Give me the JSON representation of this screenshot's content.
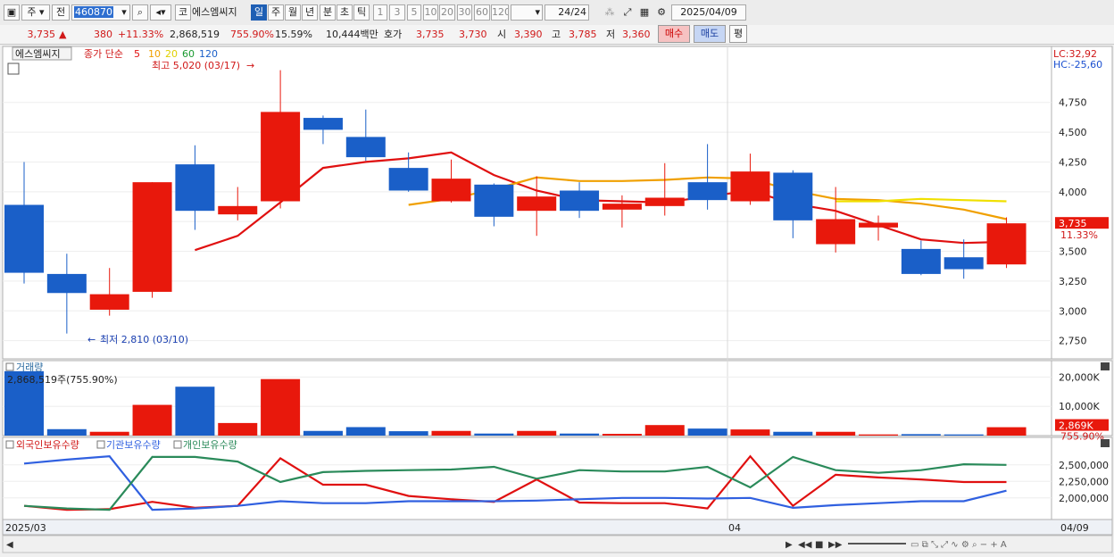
{
  "toolbar": {
    "market_sel": "주",
    "prev_sel": "전",
    "stock_code": "460870",
    "code_btn": "코",
    "stock_name": "에스엠씨지",
    "periods": [
      "일",
      "주",
      "월",
      "년",
      "분",
      "초",
      "틱"
    ],
    "active_period": "일",
    "intervals": [
      "1",
      "3",
      "5",
      "10",
      "20",
      "30",
      "60",
      "120"
    ],
    "count": "24",
    "count_total": "/24",
    "date": "2025/04/09"
  },
  "quote": {
    "price": "3,735",
    "change_arrow": "▲",
    "change": "380",
    "change_pct": "+11.33%",
    "volume": "2,868,519",
    "volume_ratio": "755.90%",
    "turnover": "15.59%",
    "amount": "10,444백만",
    "hoga_label": "호가",
    "ask": "3,735",
    "bid": "3,730",
    "open_label": "시",
    "open": "3,390",
    "high_label": "고",
    "high": "3,785",
    "low_label": "저",
    "low": "3,360",
    "buy_btn": "매수",
    "sell_btn": "매도",
    "eval_btn": "평"
  },
  "colors": {
    "up": "#e8180c",
    "down": "#1a5fc8",
    "ma5": "#e01010",
    "ma10": "#f0a000",
    "ma20": "#f0e000",
    "ma60": "#1a9a30",
    "ma120": "#1a5fc8",
    "foreign": "#e01010",
    "inst": "#3060e0",
    "indiv": "#2a8a5a"
  },
  "price_panel": {
    "name_tag": "에스엠씨지",
    "legend_prefix": "종가 단순",
    "legend_periods": [
      "5",
      "10",
      "20",
      "60",
      "120"
    ],
    "max_label": "최고 5,020 (03/17)",
    "min_label": "최저 2,810 (03/10)",
    "lc": "LC:32,92",
    "hc": "HC:-25,60",
    "last_price": "3,735",
    "last_pct": "11.33%"
  },
  "volume_panel": {
    "title": "거래량",
    "value_label": "2,868,519주(755.90%)",
    "last_value": "2,869K",
    "last_pct": "755.90%"
  },
  "holders_panel": {
    "legend": [
      "외국인보유수량",
      "기관보유수량",
      "개인보유수량"
    ]
  },
  "x_axis": {
    "labels": [
      "2025/03",
      "04",
      "04/09"
    ]
  },
  "chart_data": [
    {
      "type": "candlestick",
      "title": "에스엠씨지",
      "ylim": [
        2650,
        5100
      ],
      "y_ticks": [
        2750,
        3000,
        3250,
        3500,
        3750,
        4000,
        4250,
        4500,
        4750
      ],
      "y_tick_labels": [
        "2,750",
        "3,000",
        "3,250",
        "3,500",
        "3,750",
        "4,000",
        "4,250",
        "4,500",
        "4,750"
      ],
      "candles": [
        {
          "o": 3890,
          "h": 4250,
          "l": 3230,
          "c": 3320
        },
        {
          "o": 3310,
          "h": 3480,
          "l": 2810,
          "c": 3150
        },
        {
          "o": 3010,
          "h": 3360,
          "l": 2960,
          "c": 3140
        },
        {
          "o": 3160,
          "h": 4080,
          "l": 3110,
          "c": 4080
        },
        {
          "o": 4230,
          "h": 4390,
          "l": 3680,
          "c": 3840
        },
        {
          "o": 3810,
          "h": 4040,
          "l": 3760,
          "c": 3880
        },
        {
          "o": 3920,
          "h": 5020,
          "l": 3860,
          "c": 4670
        },
        {
          "o": 4620,
          "h": 4640,
          "l": 4400,
          "c": 4520
        },
        {
          "o": 4460,
          "h": 4690,
          "l": 4260,
          "c": 4290
        },
        {
          "o": 4200,
          "h": 4330,
          "l": 4000,
          "c": 4010
        },
        {
          "o": 3920,
          "h": 4270,
          "l": 3910,
          "c": 4110
        },
        {
          "o": 4060,
          "h": 4070,
          "l": 3710,
          "c": 3790
        },
        {
          "o": 3840,
          "h": 4130,
          "l": 3630,
          "c": 3960
        },
        {
          "o": 4010,
          "h": 4080,
          "l": 3780,
          "c": 3840
        },
        {
          "o": 3850,
          "h": 3970,
          "l": 3700,
          "c": 3900
        },
        {
          "o": 3880,
          "h": 4240,
          "l": 3800,
          "c": 3950
        },
        {
          "o": 4080,
          "h": 4400,
          "l": 3850,
          "c": 3930
        },
        {
          "o": 3920,
          "h": 4320,
          "l": 3890,
          "c": 4170
        },
        {
          "o": 4160,
          "h": 4180,
          "l": 3610,
          "c": 3760
        },
        {
          "o": 3560,
          "h": 4040,
          "l": 3490,
          "c": 3770
        },
        {
          "o": 3700,
          "h": 3800,
          "l": 3590,
          "c": 3740
        },
        {
          "o": 3520,
          "h": 3590,
          "l": 3300,
          "c": 3310
        },
        {
          "o": 3450,
          "h": 3600,
          "l": 3270,
          "c": 3350
        },
        {
          "o": 3390,
          "h": 3785,
          "l": 3360,
          "c": 3735
        }
      ],
      "series": [
        {
          "name": "5",
          "values": [
            null,
            null,
            null,
            null,
            3510,
            3630,
            3910,
            4200,
            4250,
            4280,
            4330,
            4140,
            4010,
            3930,
            3920,
            3910,
            3960,
            4010,
            3900,
            3840,
            3720,
            3600,
            3570,
            3580
          ]
        },
        {
          "name": "10",
          "values": [
            null,
            null,
            null,
            null,
            null,
            null,
            null,
            null,
            null,
            3890,
            3940,
            4020,
            4120,
            4090,
            4090,
            4100,
            4120,
            4110,
            4010,
            3940,
            3930,
            3900,
            3850,
            3770,
            3740
          ]
        },
        {
          "name": "20",
          "values": [
            null,
            null,
            null,
            null,
            null,
            null,
            null,
            null,
            null,
            null,
            null,
            null,
            null,
            null,
            null,
            null,
            null,
            null,
            null,
            3920,
            3920,
            3940,
            3930,
            3920
          ]
        }
      ]
    },
    {
      "type": "bar",
      "title": "거래량",
      "ylim": [
        0,
        25000000
      ],
      "y_tick_labels": [
        "20,000K",
        "10,000K"
      ],
      "values": [
        22000000,
        2200000,
        1300000,
        10500000,
        16700000,
        4300000,
        19300000,
        1600000,
        2900000,
        1500000,
        1600000,
        700000,
        1600000,
        700000,
        600000,
        3600000,
        2400000,
        2100000,
        1300000,
        1300000,
        400000,
        500000,
        400000,
        2868519
      ]
    },
    {
      "type": "line",
      "title": "보유수량",
      "ylim": [
        1700000,
        2700000
      ],
      "y_ticks": [
        2000000,
        2250000,
        2500000
      ],
      "y_tick_labels": [
        "2,000,000",
        "2,250,000",
        "2,500,000"
      ],
      "series": [
        {
          "name": "외국인보유수량",
          "values": [
            1880000,
            1820000,
            1830000,
            1940000,
            1850000,
            1880000,
            2600000,
            2200000,
            2200000,
            2030000,
            1980000,
            1940000,
            2280000,
            1930000,
            1920000,
            1920000,
            1840000,
            2630000,
            1880000,
            2350000,
            2310000,
            2280000,
            2240000,
            2240000
          ]
        },
        {
          "name": "기관보유수량",
          "values": [
            2520000,
            2580000,
            2630000,
            1820000,
            1840000,
            1880000,
            1950000,
            1920000,
            1920000,
            1950000,
            1950000,
            1950000,
            1960000,
            1980000,
            2000000,
            2000000,
            1990000,
            2000000,
            1850000,
            1890000,
            1920000,
            1950000,
            1950000,
            2110000
          ]
        },
        {
          "name": "개인보유수량",
          "values": [
            1880000,
            1840000,
            1820000,
            2620000,
            2620000,
            2550000,
            2240000,
            2390000,
            2410000,
            2420000,
            2430000,
            2470000,
            2290000,
            2420000,
            2400000,
            2400000,
            2470000,
            2160000,
            2620000,
            2420000,
            2380000,
            2420000,
            2510000,
            2500000
          ]
        }
      ]
    }
  ]
}
